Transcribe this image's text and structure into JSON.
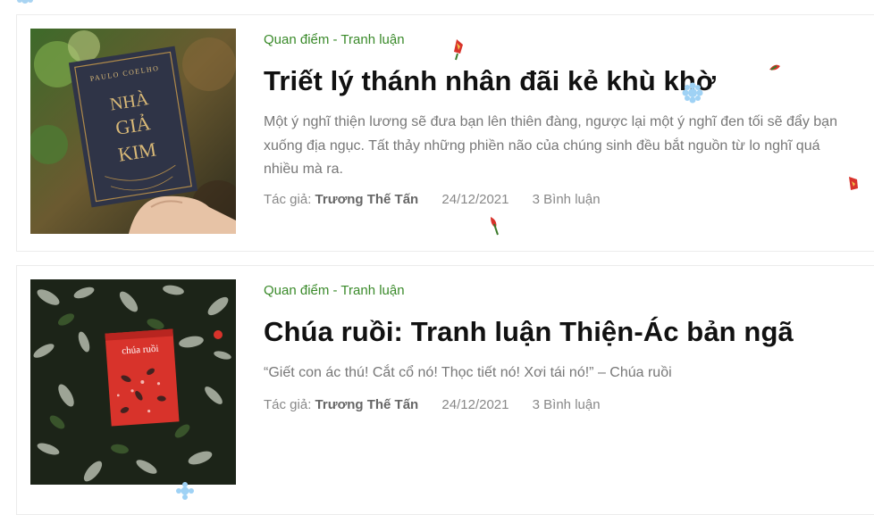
{
  "posts": [
    {
      "category": "Quan điểm - Tranh luận",
      "title": "Triết lý thánh nhân đãi kẻ khù khờ",
      "excerpt": "Một ý nghĩ thiện lương sẽ đưa bạn lên thiên đàng, ngược lại một ý nghĩ đen tối sẽ đẩy bạn xuống địa ngục. Tất thảy những phiền não của chúng sinh đều bắt nguồn từ lo nghĩ quá nhiều mà ra.",
      "author_label": "Tác giả:",
      "author": "Trương Thế Tấn",
      "date": "24/12/2021",
      "comments": "3 Bình luận",
      "cover_author": "PAULO COELHO",
      "cover_title_1": "NHÀ",
      "cover_title_2": "GIẢ",
      "cover_title_3": "KIM"
    },
    {
      "category": "Quan điểm - Tranh luận",
      "title": "Chúa ruồi: Tranh luận Thiện-Ác bản ngã",
      "excerpt": "“Giết con ác thú! Cắt cổ nó! Thọc tiết nó! Xơi tái nó!” – Chúa ruồi",
      "author_label": "Tác giả:",
      "author": "Trương Thế Tấn",
      "date": "24/12/2021",
      "comments": "3 Bình luận",
      "cover_title": "chúa ruồi"
    }
  ],
  "colors": {
    "category": "#3a8a2a",
    "title": "#111111",
    "excerpt": "#777777",
    "meta": "#888888"
  },
  "icons": [
    "snowflake-icon",
    "flower-petal-icon"
  ]
}
